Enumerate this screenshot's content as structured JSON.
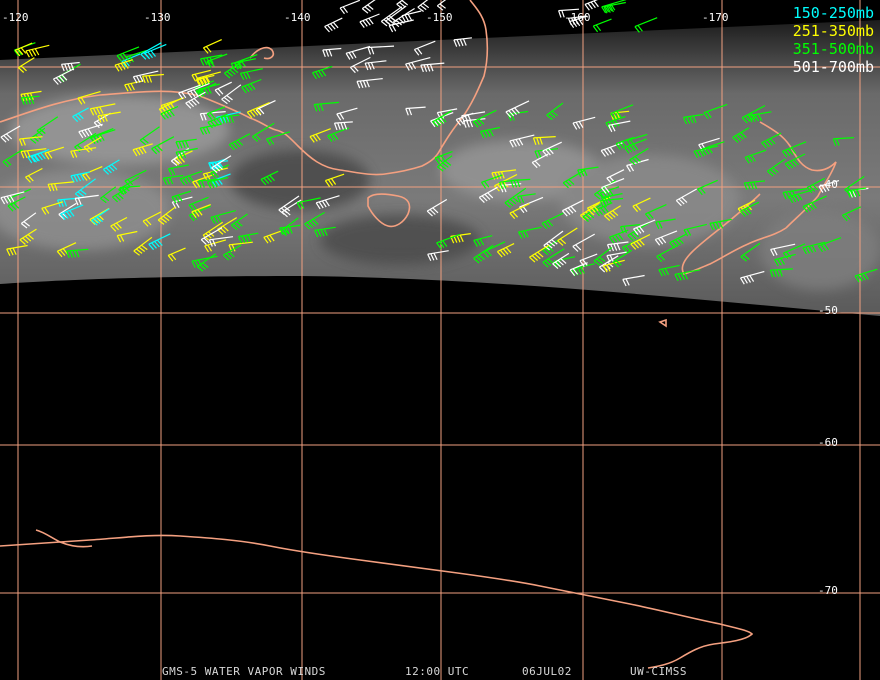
{
  "legend": [
    {
      "label": "150-250mb",
      "color": "#00ffff"
    },
    {
      "label": "251-350mb",
      "color": "#ffff00"
    },
    {
      "label": "351-500mb",
      "color": "#00ff00"
    },
    {
      "label": "501-700mb",
      "color": "#ffffff"
    }
  ],
  "longitudes": [
    "-120",
    "-130",
    "-140",
    "-150",
    "-160",
    "-170"
  ],
  "latitudes": [
    "-40",
    "-50",
    "-60",
    "-70"
  ],
  "footer": {
    "satellite": "GMS-5 WATER VAPOR WINDS",
    "time": "12:00 UTC",
    "date": "06JUL02",
    "credit": "UW-CIMSS"
  },
  "colors": {
    "gridline": "#f0a080",
    "coastline": "#f4a080",
    "background": "#000000"
  }
}
